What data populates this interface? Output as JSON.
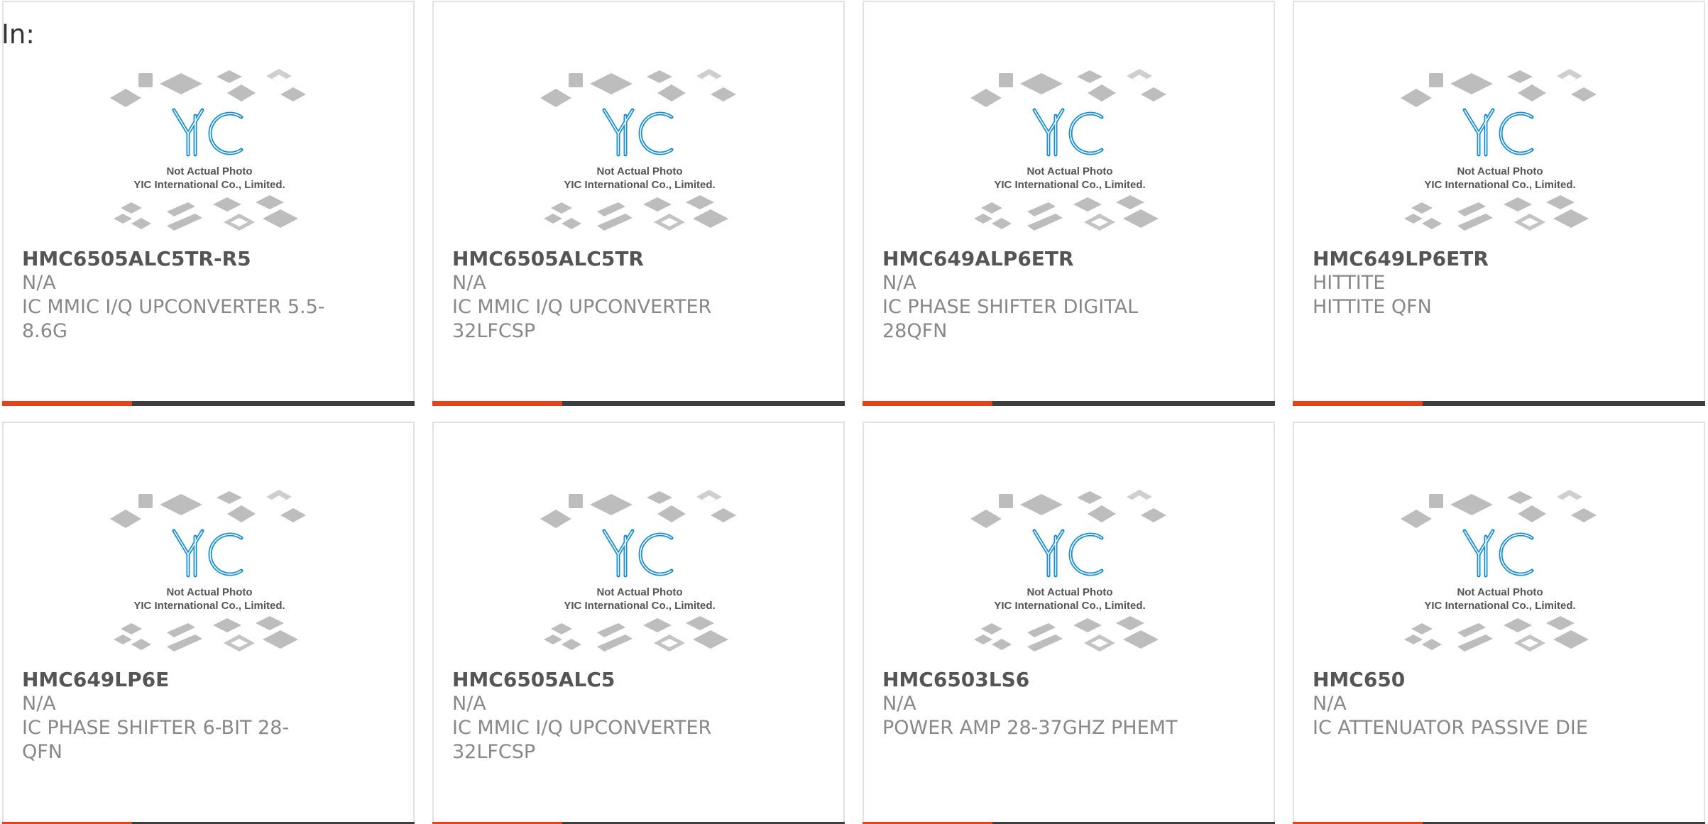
{
  "header": {
    "label": "In:"
  },
  "placeholder": {
    "line1": "Not Actual Photo",
    "line2": "YIC International Co., Limited.",
    "logo": "YIC"
  },
  "colors": {
    "accent": "#e8421a",
    "bar": "#3e3e3e",
    "logo_blue": "#1a8fd0"
  },
  "products": [
    {
      "part": "HMC6505ALC5TR-R5",
      "mfr": "N/A",
      "desc": "IC MMIC I/Q UPCONVERTER 5.5-8.6G"
    },
    {
      "part": "HMC6505ALC5TR",
      "mfr": "N/A",
      "desc": "IC MMIC I/Q UPCONVERTER 32LFCSP"
    },
    {
      "part": "HMC649ALP6ETR",
      "mfr": "N/A",
      "desc": "IC PHASE SHIFTER DIGITAL 28QFN"
    },
    {
      "part": "HMC649LP6ETR",
      "mfr": "HITTITE",
      "desc": "HITTITE QFN"
    },
    {
      "part": "HMC649LP6E",
      "mfr": "N/A",
      "desc": "IC PHASE SHIFTER 6-BIT 28-QFN"
    },
    {
      "part": "HMC6505ALC5",
      "mfr": "N/A",
      "desc": "IC MMIC I/Q UPCONVERTER 32LFCSP"
    },
    {
      "part": "HMC6503LS6",
      "mfr": "N/A",
      "desc": "POWER AMP 28-37GHZ PHEMT"
    },
    {
      "part": "HMC650",
      "mfr": "N/A",
      "desc": "IC ATTENUATOR PASSIVE DIE"
    }
  ]
}
